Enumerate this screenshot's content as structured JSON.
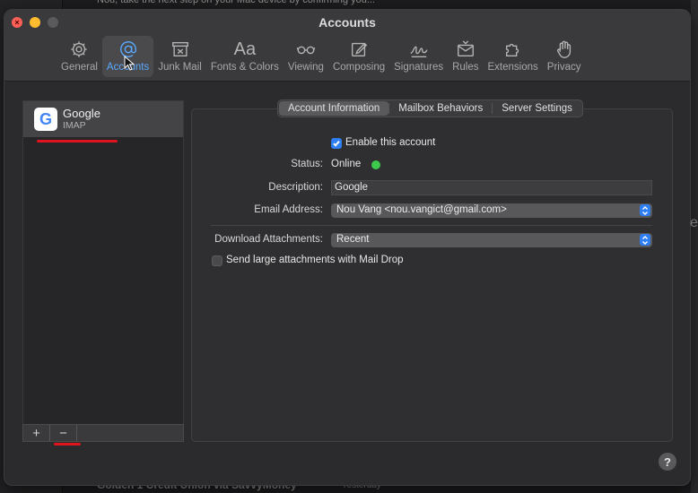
{
  "background": {
    "top_email_preview": "Nou, take the next step on your Mac device by confirming you...",
    "bottom_email_sender": "Golden 1 Credit Union via SavvyMoney",
    "bottom_email_time": "Yesterday"
  },
  "window": {
    "title": "Accounts"
  },
  "toolbar": {
    "items": [
      {
        "label": "General",
        "icon": "gear-icon"
      },
      {
        "label": "Accounts",
        "icon": "at-sign-icon"
      },
      {
        "label": "Junk Mail",
        "icon": "junk-tray-icon"
      },
      {
        "label": "Fonts & Colors",
        "icon": "font-aa-icon"
      },
      {
        "label": "Viewing",
        "icon": "glasses-icon"
      },
      {
        "label": "Composing",
        "icon": "compose-pencil-icon"
      },
      {
        "label": "Signatures",
        "icon": "signature-icon"
      },
      {
        "label": "Rules",
        "icon": "rules-envelope-icon"
      },
      {
        "label": "Extensions",
        "icon": "puzzle-piece-icon"
      },
      {
        "label": "Privacy",
        "icon": "hand-icon"
      }
    ],
    "active": "Accounts"
  },
  "sidebar": {
    "accounts": [
      {
        "name": "Google",
        "type": "IMAP",
        "logo_letter": "G"
      }
    ],
    "add_label": "+",
    "remove_label": "−"
  },
  "tabs": {
    "items": [
      "Account Information",
      "Mailbox Behaviors",
      "Server Settings"
    ],
    "selected": "Account Information"
  },
  "form": {
    "enable_label": "Enable this account",
    "enable_checked": true,
    "status_label": "Status:",
    "status_value": "Online",
    "status_color": "#3cc94c",
    "description_label": "Description:",
    "description_value": "Google",
    "email_label": "Email Address:",
    "email_value": "Nou Vang <nou.vangict@gmail.com>",
    "download_label": "Download Attachments:",
    "download_value": "Recent",
    "maildrop_label": "Send large attachments with Mail Drop",
    "maildrop_checked": false
  },
  "help": "?"
}
